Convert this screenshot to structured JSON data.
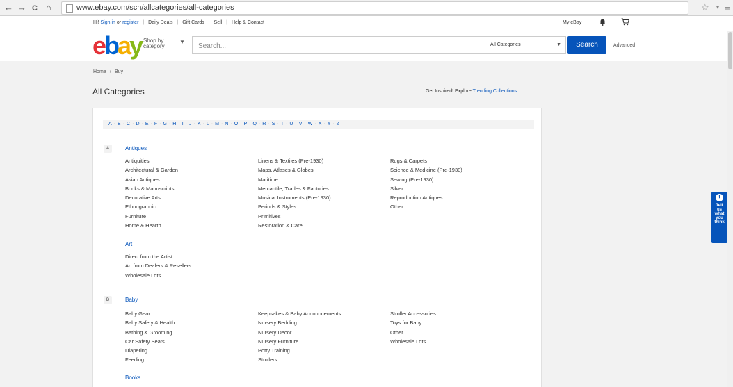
{
  "browser": {
    "back": "←",
    "forward": "→",
    "reload": "C",
    "home": "⌂",
    "url": "www.ebay.com/sch/allcategories/all-categories",
    "star": "☆",
    "menu": "≡",
    "extra": "▾"
  },
  "topbar": {
    "greeting": "Hi!",
    "sign_in": "Sign in",
    "or": "or",
    "register": "register",
    "links": [
      "Daily Deals",
      "Gift Cards",
      "Sell",
      "Help & Contact"
    ],
    "my_ebay": "My eBay",
    "bell_icon": "🔔",
    "cart_icon": "🛒"
  },
  "header": {
    "logo": [
      "e",
      "b",
      "a",
      "y"
    ],
    "shop_by_line1": "Shop by",
    "shop_by_line2": "category",
    "search_placeholder": "Search...",
    "category_select": "All Categories",
    "search_button": "Search",
    "advanced": "Advanced"
  },
  "breadcrumb": {
    "home": "Home",
    "sep": "›",
    "current": "Buy"
  },
  "page_title": "All Categories",
  "inspired": {
    "text": "Get Inspired! Explore",
    "link": "Trending Collections"
  },
  "alphabet": [
    "A",
    "B",
    "C",
    "D",
    "E",
    "F",
    "G",
    "H",
    "I",
    "J",
    "K",
    "L",
    "M",
    "N",
    "O",
    "P",
    "Q",
    "R",
    "S",
    "T",
    "U",
    "V",
    "W",
    "X",
    "Y",
    "Z"
  ],
  "sections": {
    "a": {
      "letter": "A",
      "antiques": {
        "title": "Antiques",
        "col1": [
          "Antiquities",
          "Architectural & Garden",
          "Asian Antiques",
          "Books & Manuscripts",
          "Decorative Arts",
          "Ethnographic",
          "Furniture",
          "Home & Hearth"
        ],
        "col2": [
          "Linens & Textiles (Pre-1930)",
          "Maps, Atlases & Globes",
          "Maritime",
          "Mercantile, Trades & Factories",
          "Musical Instruments (Pre-1930)",
          "Periods & Styles",
          "Primitives",
          "Restoration & Care"
        ],
        "col3": [
          "Rugs & Carpets",
          "Science & Medicine (Pre-1930)",
          "Sewing (Pre-1930)",
          "Silver",
          "Reproduction Antiques",
          "Other"
        ]
      },
      "art": {
        "title": "Art",
        "col1": [
          "Direct from the Artist",
          "Art from Dealers & Resellers",
          "Wholesale Lots"
        ]
      }
    },
    "b": {
      "letter": "B",
      "baby": {
        "title": "Baby",
        "col1": [
          "Baby Gear",
          "Baby Safety & Health",
          "Bathing & Grooming",
          "Car Safety Seats",
          "Diapering",
          "Feeding"
        ],
        "col2": [
          "Keepsakes & Baby Announcements",
          "Nursery Bedding",
          "Nursery Decor",
          "Nursery Furniture",
          "Potty Training",
          "Strollers"
        ],
        "col3": [
          "Stroller Accessories",
          "Toys for Baby",
          "Other",
          "Wholesale Lots"
        ]
      },
      "books": {
        "title": "Books"
      }
    }
  },
  "feedback": {
    "icon": "!",
    "lines": [
      "Tell",
      "us",
      "what",
      "you",
      "think"
    ]
  },
  "colors": {
    "link": "#0654ba",
    "search_button": "#0654ba",
    "logo_e": "#e53238",
    "logo_b": "#0064d2",
    "logo_a": "#f5af02",
    "logo_y": "#86b817"
  }
}
